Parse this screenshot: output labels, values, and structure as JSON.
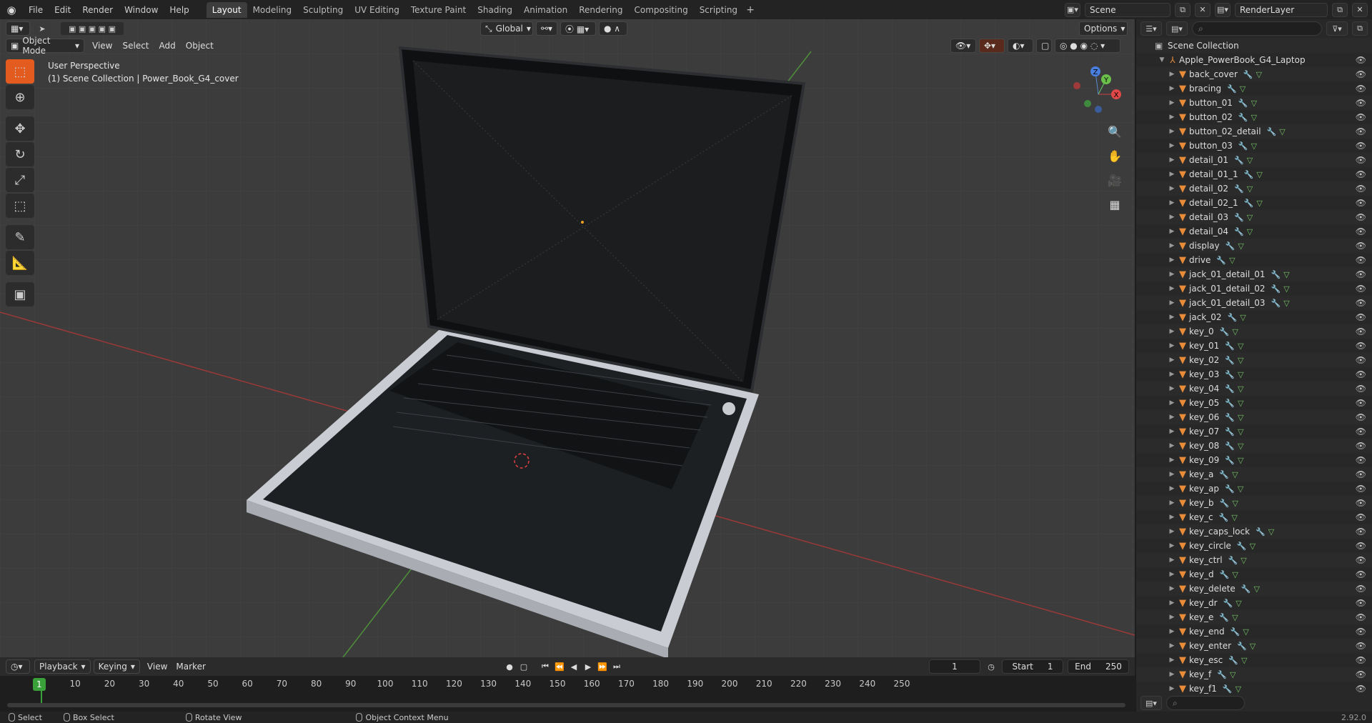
{
  "topbar": {
    "menu": [
      "File",
      "Edit",
      "Render",
      "Window",
      "Help"
    ],
    "tabs": [
      "Layout",
      "Modeling",
      "Sculpting",
      "UV Editing",
      "Texture Paint",
      "Shading",
      "Animation",
      "Rendering",
      "Compositing",
      "Scripting"
    ],
    "active_tab": "Layout",
    "scene": "Scene",
    "view_layer": "RenderLayer"
  },
  "viewport": {
    "mode": "Object Mode",
    "menu": [
      "View",
      "Select",
      "Add",
      "Object"
    ],
    "orientation": "Global",
    "options_label": "Options",
    "perspective_label": "User Perspective",
    "context_label": "(1) Scene Collection | Power_Book_G4_cover",
    "gizmo_axes": [
      "X",
      "Y",
      "Z"
    ]
  },
  "outliner": {
    "root": "Scene Collection",
    "collection": "Apple_PowerBook_G4_Laptop",
    "items": [
      "back_cover",
      "bracing",
      "button_01",
      "button_02",
      "button_02_detail",
      "button_03",
      "detail_01",
      "detail_01_1",
      "detail_02",
      "detail_02_1",
      "detail_03",
      "detail_04",
      "display",
      "drive",
      "jack_01_detail_01",
      "jack_01_detail_02",
      "jack_01_detail_03",
      "jack_02",
      "key_0",
      "key_01",
      "key_02",
      "key_03",
      "key_04",
      "key_05",
      "key_06",
      "key_07",
      "key_08",
      "key_09",
      "key_a",
      "key_ap",
      "key_b",
      "key_c",
      "key_caps_lock",
      "key_circle",
      "key_ctrl",
      "key_d",
      "key_delete",
      "key_dr",
      "key_e",
      "key_end",
      "key_enter",
      "key_esc",
      "key_f",
      "key_f1"
    ]
  },
  "timeline": {
    "menu": [
      "Playback",
      "Keying",
      "View",
      "Marker"
    ],
    "current_frame": "1",
    "start_label": "Start",
    "start": "1",
    "end_label": "End",
    "end": "250",
    "ticks": [
      "10",
      "20",
      "30",
      "40",
      "50",
      "60",
      "70",
      "80",
      "90",
      "100",
      "110",
      "120",
      "130",
      "140",
      "150",
      "160",
      "170",
      "180",
      "190",
      "200",
      "210",
      "220",
      "230",
      "240",
      "250"
    ],
    "playhead": "1"
  },
  "statusbar": {
    "select": "Select",
    "box_select": "Box Select",
    "rotate": "Rotate View",
    "context_menu": "Object Context Menu",
    "version": "2.92.0"
  },
  "colors": {
    "accent": "#4772b3",
    "object_orange": "#e88c3a",
    "playhead_green": "#3aa03a"
  }
}
